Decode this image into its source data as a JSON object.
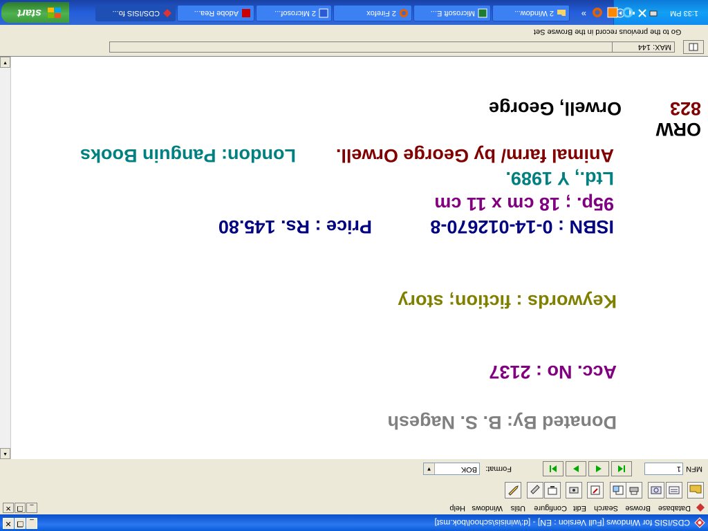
{
  "window": {
    "title": "CDS/ISIS for Windows [Full Version : EN] - [d:\\winisis\\school\\bok.mst]",
    "controls": {
      "minimize": "_",
      "restore": "❐",
      "close": "✕"
    }
  },
  "menubar": {
    "items": [
      "Database",
      "Browse",
      "Search",
      "Edit",
      "Configure",
      "Utils",
      "Windows",
      "Help"
    ]
  },
  "toolbar": {
    "buttons": [
      "open-database",
      "dictionary",
      "search",
      "print",
      "import",
      "export",
      "edit",
      "print-record",
      "configure",
      "utils"
    ]
  },
  "navbar": {
    "mfn_label": "MFN",
    "mfn_value": "1",
    "format_label": "Format:",
    "format_value": "BOK"
  },
  "record": {
    "mfn": "823",
    "author": "Orwell, George",
    "call_no": "ORW",
    "title_line1": "Animal farm/ by George Orwell.",
    "publisher_part1": "London: Panguin Books",
    "publisher_part2": "Ltd., Y 1989.",
    "collation": "95p. ; 18 cm x 11 cm",
    "isbn": "ISBN :  0-14-012670-8",
    "price": "Price :  Rs. 145.80",
    "keywords": "Keywords : fiction; story",
    "acc_no": "Acc. No :  2137",
    "donated_by": "Donated By:  B. S. Nagesh"
  },
  "statusbar": {
    "max_label": "MAX: 144",
    "hint": "Go to the previous record in the Browse Set"
  },
  "taskbar": {
    "start_label": "start",
    "tasks": [
      {
        "label": "2 Window...",
        "icon": "folder-icon"
      },
      {
        "label": "Microsoft E...",
        "icon": "excel-icon"
      },
      {
        "label": "2 Firefox",
        "icon": "firefox-icon"
      },
      {
        "label": "2 Microsof...",
        "icon": "word-icon"
      },
      {
        "label": "Adobe Rea...",
        "icon": "acrobat-icon"
      },
      {
        "label": "CDS/ISIS fo...",
        "icon": "isis-icon"
      }
    ],
    "overflow": "»",
    "clock": "1:33 PM"
  },
  "colors": {
    "mfn": "#800000",
    "author": "#000000",
    "title": "#800000",
    "publisher": "#008080",
    "collation": "#800080",
    "isbn": "#000080",
    "keywords": "#808000",
    "acc_no": "#800080",
    "donated_by": "#808080"
  }
}
